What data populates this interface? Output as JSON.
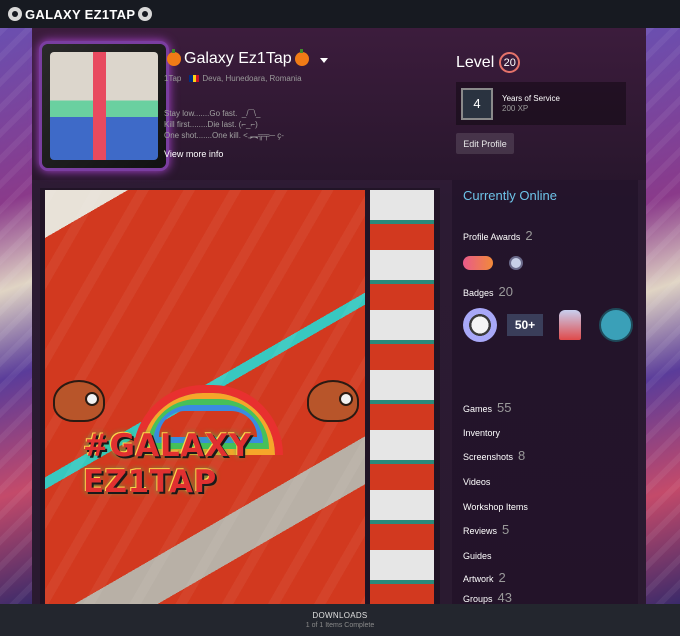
{
  "titlebar": {
    "icon": "steam-emblem-icon",
    "title": "GALAXY EZ1TAP"
  },
  "profile": {
    "persona_name": "Galaxy Ez1Tap",
    "username": "1Tap",
    "location": "Deva, Hunedoara, Romania",
    "summary_lines": [
      "Stay low.......Go fast.  _/‾‾\\_",
      "Kill first........Die last. (⌐_⌐)",
      "One shot.......One kill. <,︻╦╤─ ҫ-"
    ],
    "view_more": "View more info",
    "flag_colors": [
      "#002b7f",
      "#fcd116",
      "#ce1126"
    ]
  },
  "level": {
    "label": "Level",
    "value": "20",
    "circle_color": "#e5736a"
  },
  "featured_badge": {
    "number": "4",
    "name": "Years of Service",
    "xp": "200 XP"
  },
  "edit_profile_label": "Edit Profile",
  "showcase": {
    "banner_text": "#GALAXY EZ1TAP"
  },
  "sidebar": {
    "status": "Currently Online",
    "status_color": "#6dc3e8",
    "profile_awards": {
      "label": "Profile Awards",
      "count": "2"
    },
    "badges": {
      "label": "Badges",
      "count": "20",
      "badge_50": "50+"
    },
    "items": [
      {
        "label": "Games",
        "count": "55"
      },
      {
        "label": "Inventory",
        "count": ""
      },
      {
        "label": "Screenshots",
        "count": "8"
      },
      {
        "label": "Videos",
        "count": ""
      },
      {
        "label": "Workshop Items",
        "count": ""
      },
      {
        "label": "Reviews",
        "count": "5"
      },
      {
        "label": "Guides",
        "count": ""
      },
      {
        "label": "Artwork",
        "count": "2"
      },
      {
        "label": "Groups",
        "count": "43"
      }
    ]
  },
  "downloads": {
    "title": "DOWNLOADS",
    "status": "1 of 1 Items Complete"
  }
}
